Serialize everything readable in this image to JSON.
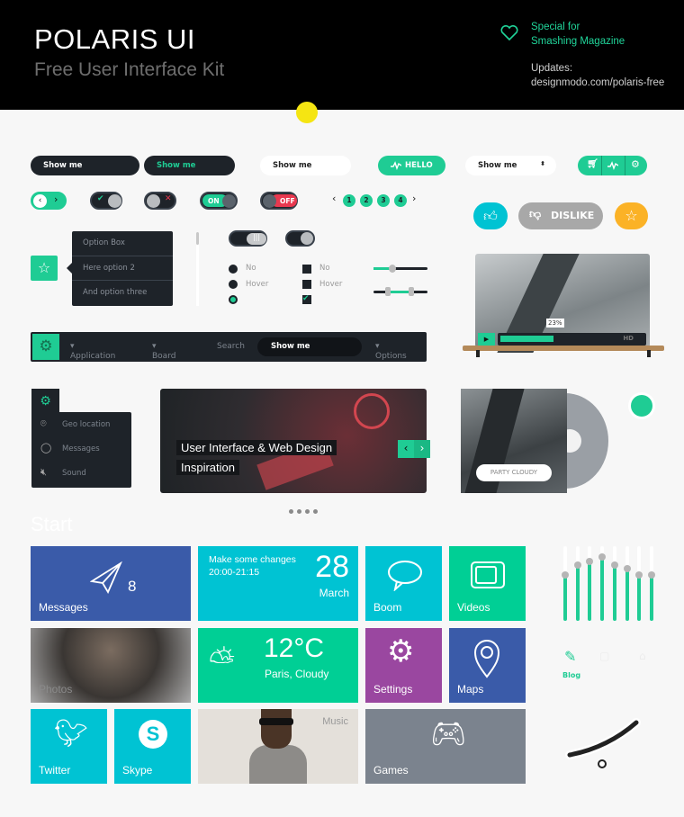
{
  "header": {
    "title": "POLARIS UI",
    "subtitle": "Free User Interface Kit",
    "special_line1": "Special for",
    "special_line2": "Smashing Magazine",
    "updates_label": "Updates:",
    "updates_url": "designmodo.com/polaris-free"
  },
  "colors": {
    "accent": "#1fcc94",
    "dark": "#1e2329",
    "blue": "#3a5ba9",
    "cyan": "#00c3d3",
    "purple": "#9a47a0",
    "gray": "#7b838e",
    "orange": "#fbb226",
    "red": "#e8384f"
  },
  "inputs": [
    "Show me",
    "Show me",
    "Show me"
  ],
  "hello_button": "HELLO",
  "select": {
    "value": "Show me"
  },
  "button_group": [
    "cart-icon",
    "activity-icon",
    "gear-icon"
  ],
  "toggles": {
    "on": "ON",
    "off": "OFF"
  },
  "pagination": [
    "1",
    "2",
    "3",
    "4"
  ],
  "dislike_button": "DISLIKE",
  "dropdown": [
    "Option Box",
    "Here option 2",
    "And option three"
  ],
  "radios": [
    "No",
    "Hover",
    ""
  ],
  "checkboxes": [
    "No",
    "Hover",
    ""
  ],
  "video": {
    "progress_label": "23%",
    "progress": 0.23,
    "hd": "HD"
  },
  "navbar": {
    "items": [
      "Application",
      "Board",
      "Search",
      "Options"
    ],
    "search_value": "Show me"
  },
  "side_menu": [
    "Geo location",
    "Messages",
    "Sound"
  ],
  "slider": {
    "line1": "User Interface & Web Design",
    "line2": "Inspiration",
    "dots": 4
  },
  "album": {
    "button": "PARTY CLOUDY"
  },
  "start_label": "Start",
  "tiles": {
    "messages": "Messages",
    "messages_count": "8",
    "calendar_event": "Make some changes",
    "calendar_time": "20:00-21:15",
    "calendar_day": "28",
    "calendar_month": "March",
    "boom": "Boom",
    "videos": "Videos",
    "photos": "Photos",
    "weather_temp": "12°C",
    "weather_place": "Paris, Cloudy",
    "settings": "Settings",
    "maps": "Maps",
    "twitter": "Twitter",
    "skype": "Skype",
    "music": "Music",
    "games": "Games"
  },
  "equalizer": [
    0.62,
    0.75,
    0.8,
    0.86,
    0.75,
    0.7,
    0.62,
    0.62
  ],
  "blog_label": "Blog"
}
